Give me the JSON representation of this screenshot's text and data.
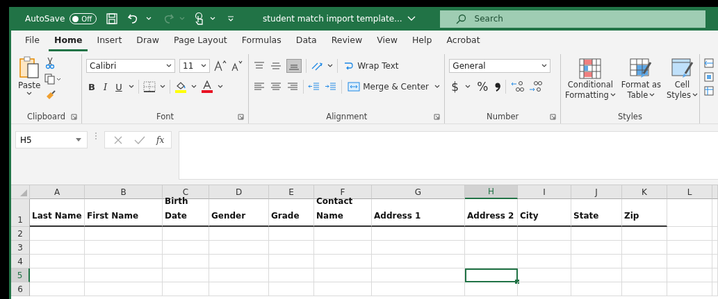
{
  "title_bar": {
    "autosave_label": "AutoSave",
    "autosave": {
      "label": "Off",
      "on": false
    },
    "title": "student match import template...",
    "search": {
      "placeholder": "Search"
    }
  },
  "tabs": [
    {
      "label": "File",
      "selected": false
    },
    {
      "label": "Home",
      "selected": true
    },
    {
      "label": "Insert",
      "selected": false
    },
    {
      "label": "Draw",
      "selected": false
    },
    {
      "label": "Page Layout",
      "selected": false
    },
    {
      "label": "Formulas",
      "selected": false
    },
    {
      "label": "Data",
      "selected": false
    },
    {
      "label": "Review",
      "selected": false
    },
    {
      "label": "View",
      "selected": false
    },
    {
      "label": "Help",
      "selected": false
    },
    {
      "label": "Acrobat",
      "selected": false
    }
  ],
  "ribbon": {
    "clipboard": {
      "paste": "Paste",
      "label": "Clipboard"
    },
    "font": {
      "name": "Calibri",
      "size": "11",
      "bold": "B",
      "italic": "I",
      "underline": "U",
      "label": "Font"
    },
    "alignment": {
      "wrap_text": "Wrap Text",
      "merge": "Merge & Center",
      "label": "Alignment"
    },
    "number": {
      "format": "General",
      "currency": "$",
      "percent": "%",
      "label": "Number"
    },
    "styles": {
      "buttons": [
        {
          "lines": [
            "Conditional",
            "Formatting"
          ]
        },
        {
          "lines": [
            "Format as",
            "Table"
          ]
        },
        {
          "lines": [
            "Cell",
            "Styles"
          ]
        }
      ],
      "label": "Styles"
    }
  },
  "formula_bar": {
    "name_box": "H5",
    "fx": "fx"
  },
  "sheet": {
    "columns": [
      {
        "label": "A",
        "selected": false
      },
      {
        "label": "B",
        "selected": false
      },
      {
        "label": "C",
        "selected": false
      },
      {
        "label": "D",
        "selected": false
      },
      {
        "label": "E",
        "selected": false
      },
      {
        "label": "F",
        "selected": false
      },
      {
        "label": "G",
        "selected": false
      },
      {
        "label": "H",
        "selected": true
      },
      {
        "label": "I",
        "selected": false
      },
      {
        "label": "J",
        "selected": false
      },
      {
        "label": "K",
        "selected": false
      },
      {
        "label": "L",
        "selected": false
      }
    ],
    "rows": [
      {
        "label": "1",
        "selected": false,
        "cells": [
          {
            "text": "Last Name",
            "wrapped": false
          },
          {
            "text": "First Name",
            "wrapped": false
          },
          {
            "text": "Birth Date",
            "wrapped": true
          },
          {
            "text": "Gender"
          },
          {
            "text": "Grade"
          },
          {
            "text": "Contact Name",
            "wrapped": true
          },
          {
            "text": "Address 1",
            "wrapped": false
          },
          {
            "text": "Address 2",
            "wrapped": false
          },
          {
            "text": "City"
          },
          {
            "text": "State"
          },
          {
            "text": "Zip"
          }
        ]
      },
      {
        "label": "2",
        "selected": false,
        "cells": []
      },
      {
        "label": "3",
        "selected": false,
        "cells": []
      },
      {
        "label": "4",
        "selected": false,
        "cells": []
      },
      {
        "label": "5",
        "selected": true,
        "cells": []
      },
      {
        "label": "6",
        "selected": false,
        "cells": []
      }
    ]
  }
}
